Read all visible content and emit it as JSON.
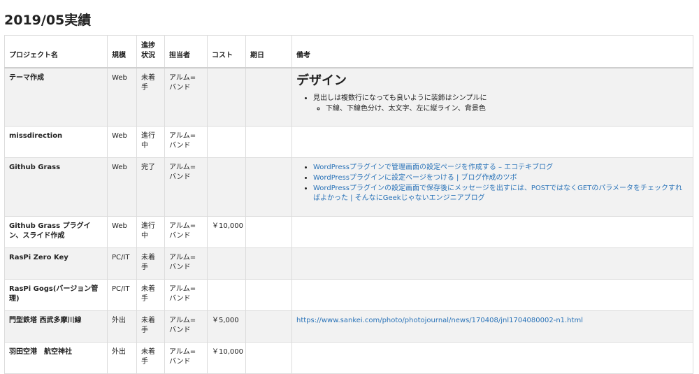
{
  "page": {
    "title": "2019/05実績"
  },
  "columns": {
    "project": "プロジェクト名",
    "scale": "規模",
    "status": "進捗状況",
    "owner": "担当者",
    "cost": "コスト",
    "deadline": "期日",
    "notes": "備考"
  },
  "rows": [
    {
      "project": "テーマ作成",
      "scale": "Web",
      "status": "未着手",
      "owner": "アルム=バンド",
      "cost": "",
      "deadline": "",
      "notes": {
        "heading": "デザイン",
        "item": "見出しは複数行になっても良いように装飾はシンプルに",
        "subitem": "下線、下線色分け、太文字、左に縦ライン、背景色"
      }
    },
    {
      "project": "missdirection",
      "scale": "Web",
      "status": "進行中",
      "owner": "アルム=バンド",
      "cost": "",
      "deadline": ""
    },
    {
      "project": "Github Grass",
      "scale": "Web",
      "status": "完了",
      "owner": "アルム=バンド",
      "cost": "",
      "deadline": "",
      "links": [
        "WordPressプラグインで管理画面の設定ページを作成する – エコテキブログ",
        "WordPressプラグインに設定ページをつける | ブログ作成のツボ",
        "WordPressプラグインの設定画面で保存後にメッセージを出すには、POSTではなくGETのパラメータをチェックすればよかった | そんなにGeekじゃないエンジニアブログ"
      ]
    },
    {
      "project": "Github Grass プラグイン、スライド作成",
      "scale": "Web",
      "status": "進行中",
      "owner": "アルム=バンド",
      "cost": "￥10,000",
      "deadline": ""
    },
    {
      "project": "RasPi Zero Key",
      "scale": "PC/IT",
      "status": "未着手",
      "owner": "アルム=バンド",
      "cost": "",
      "deadline": ""
    },
    {
      "project": "RasPi Gogs(バージョン管理)",
      "scale": "PC/IT",
      "status": "未着手",
      "owner": "アルム=バンド",
      "cost": "",
      "deadline": ""
    },
    {
      "project": "門型鉄塔 西武多摩川線",
      "scale": "外出",
      "status": "未着手",
      "owner": "アルム=バンド",
      "cost": "￥5,000",
      "deadline": "",
      "url": "https://www.sankei.com/photo/photojournal/news/170408/jnl1704080002-n1.html"
    },
    {
      "project": "羽田空港　航空神社",
      "scale": "外出",
      "status": "未着手",
      "owner": "アルム=バンド",
      "cost": "￥10,000",
      "deadline": ""
    }
  ]
}
